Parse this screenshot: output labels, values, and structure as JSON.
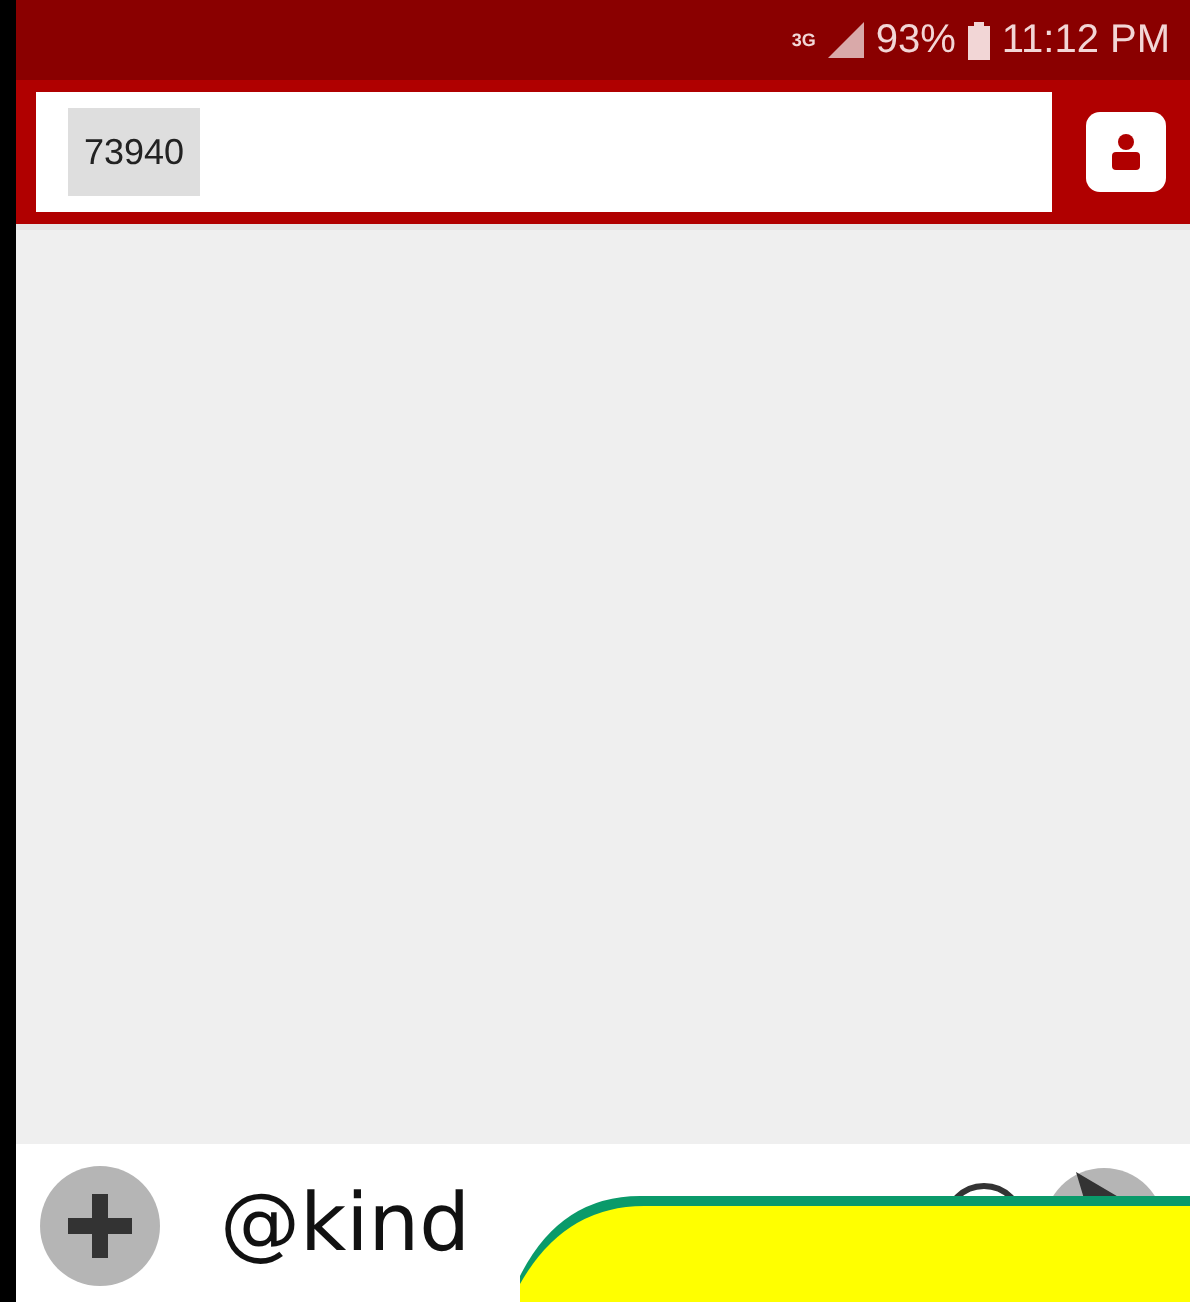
{
  "status_bar": {
    "network": "3G",
    "battery": "93%",
    "time": "11:12 PM"
  },
  "header": {
    "chip": "73940"
  },
  "compose": {
    "value": "@kind"
  },
  "popup": {
    "kind": "dialog"
  }
}
